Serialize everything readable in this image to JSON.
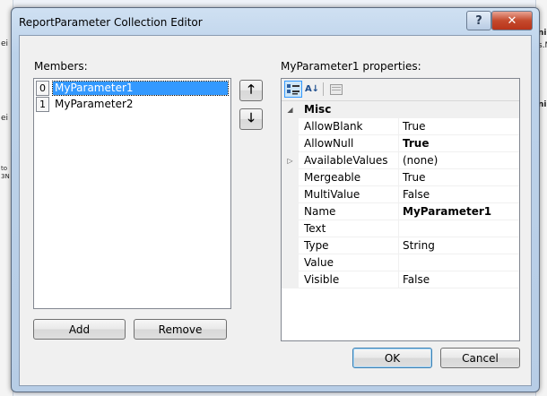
{
  "window": {
    "title": "ReportParameter Collection Editor",
    "help_label": "?",
    "close_label": "✕"
  },
  "background": {
    "frag_left_1": "ei",
    "frag_left_2": "ei",
    "frag_left_3": "to",
    "frag_left_4": "3N",
    "frag_right_1": "ni",
    "frag_right_2": "s.M",
    "frag_right_3": "ni"
  },
  "members": {
    "label": "Members:",
    "items": [
      {
        "index": "0",
        "name": "MyParameter1",
        "selected": true
      },
      {
        "index": "1",
        "name": "MyParameter2",
        "selected": false
      }
    ],
    "move_up_label": "🡑",
    "move_down_label": "🡓",
    "add_label": "Add",
    "remove_label": "Remove"
  },
  "properties": {
    "label": "MyParameter1 properties:",
    "toolbar": {
      "categorized_icon": "categorized-icon",
      "alphabetical_icon": "alphabetical-icon",
      "property_pages_icon": "property-pages-icon",
      "alphabetical_glyph": "A↓"
    },
    "category": {
      "name": "Misc",
      "glyph": "◢"
    },
    "rows": [
      {
        "name": "AllowBlank",
        "value": "True",
        "bold": false,
        "expand": ""
      },
      {
        "name": "AllowNull",
        "value": "True",
        "bold": true,
        "expand": ""
      },
      {
        "name": "AvailableValues",
        "value": "(none)",
        "bold": false,
        "expand": "▷"
      },
      {
        "name": "Mergeable",
        "value": "True",
        "bold": false,
        "expand": ""
      },
      {
        "name": "MultiValue",
        "value": "False",
        "bold": false,
        "expand": ""
      },
      {
        "name": "Name",
        "value": "MyParameter1",
        "bold": true,
        "expand": ""
      },
      {
        "name": "Text",
        "value": "",
        "bold": false,
        "expand": ""
      },
      {
        "name": "Type",
        "value": "String",
        "bold": false,
        "expand": ""
      },
      {
        "name": "Value",
        "value": "",
        "bold": false,
        "expand": ""
      },
      {
        "name": "Visible",
        "value": "False",
        "bold": false,
        "expand": ""
      }
    ]
  },
  "footer": {
    "ok_label": "OK",
    "cancel_label": "Cancel"
  }
}
